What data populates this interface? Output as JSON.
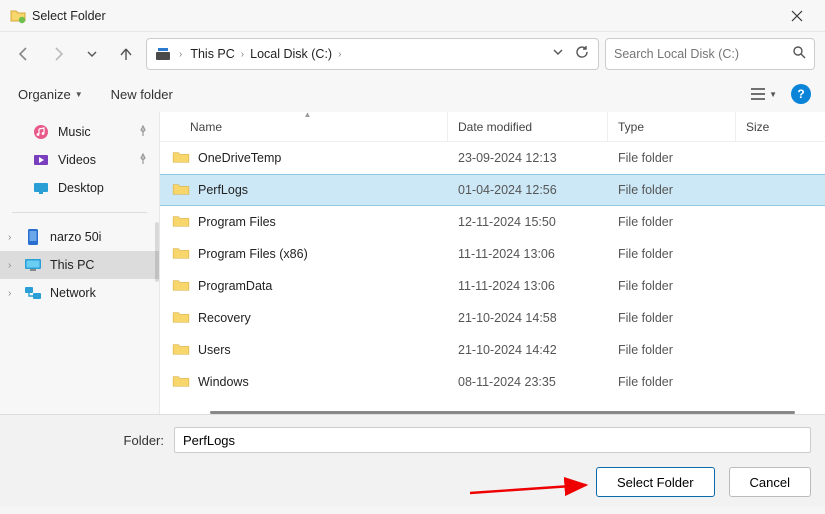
{
  "title": "Select Folder",
  "breadcrumbs": [
    "This PC",
    "Local Disk (C:)"
  ],
  "search_placeholder": "Search Local Disk (C:)",
  "toolbar": {
    "organize": "Organize",
    "new_folder": "New folder"
  },
  "sidebar": {
    "quick": [
      {
        "label": "Music",
        "icon": "music",
        "pinned": true
      },
      {
        "label": "Videos",
        "icon": "videos",
        "pinned": true
      },
      {
        "label": "Desktop",
        "icon": "desktop",
        "pinned": false
      }
    ],
    "devices": [
      {
        "label": "narzo 50i",
        "icon": "phone",
        "selected": false
      },
      {
        "label": "This PC",
        "icon": "pc",
        "selected": true
      },
      {
        "label": "Network",
        "icon": "network",
        "selected": false
      }
    ]
  },
  "columns": {
    "name": "Name",
    "date": "Date modified",
    "type": "Type",
    "size": "Size"
  },
  "files": [
    {
      "name": "OneDriveTemp",
      "date": "23-09-2024 12:13",
      "type": "File folder",
      "selected": false
    },
    {
      "name": "PerfLogs",
      "date": "01-04-2024 12:56",
      "type": "File folder",
      "selected": true
    },
    {
      "name": "Program Files",
      "date": "12-11-2024 15:50",
      "type": "File folder",
      "selected": false
    },
    {
      "name": "Program Files (x86)",
      "date": "11-11-2024 13:06",
      "type": "File folder",
      "selected": false
    },
    {
      "name": "ProgramData",
      "date": "11-11-2024 13:06",
      "type": "File folder",
      "selected": false
    },
    {
      "name": "Recovery",
      "date": "21-10-2024 14:58",
      "type": "File folder",
      "selected": false
    },
    {
      "name": "Users",
      "date": "21-10-2024 14:42",
      "type": "File folder",
      "selected": false
    },
    {
      "name": "Windows",
      "date": "08-11-2024 23:35",
      "type": "File folder",
      "selected": false
    }
  ],
  "folder_field": {
    "label": "Folder:",
    "value": "PerfLogs"
  },
  "buttons": {
    "select": "Select Folder",
    "cancel": "Cancel"
  }
}
